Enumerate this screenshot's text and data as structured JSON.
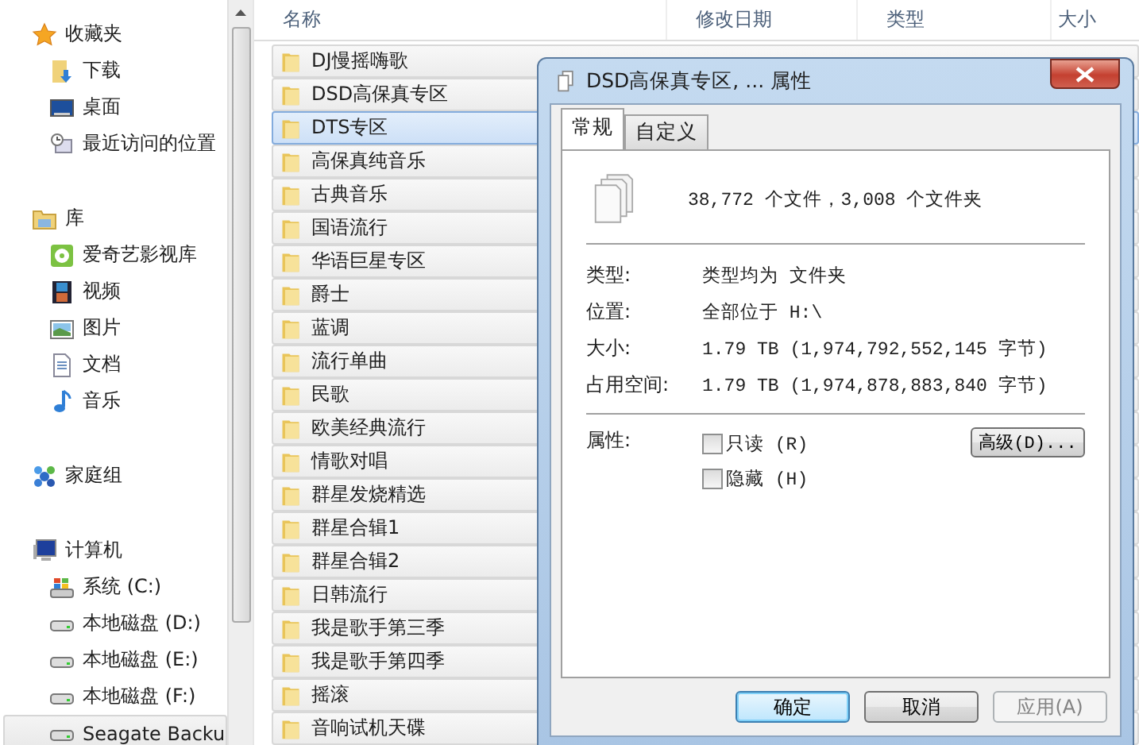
{
  "sidebar": {
    "groups": [
      {
        "label": "收藏夹",
        "kind": "favorites",
        "items": [
          {
            "label": "下载",
            "kind": "download",
            "selected": false
          },
          {
            "label": "桌面",
            "kind": "desktop",
            "selected": false
          },
          {
            "label": "最近访问的位置",
            "kind": "recent",
            "selected": false
          }
        ]
      },
      {
        "label": "库",
        "kind": "library",
        "items": [
          {
            "label": "爱奇艺影视库",
            "kind": "media",
            "selected": false
          },
          {
            "label": "视频",
            "kind": "video",
            "selected": false
          },
          {
            "label": "图片",
            "kind": "pictures",
            "selected": false
          },
          {
            "label": "文档",
            "kind": "documents",
            "selected": false
          },
          {
            "label": "音乐",
            "kind": "music",
            "selected": false
          }
        ]
      },
      {
        "label": "家庭组",
        "kind": "homegroup"
      },
      {
        "label": "计算机",
        "kind": "computer",
        "items": [
          {
            "label": "系统 (C:)",
            "kind": "system",
            "selected": false
          },
          {
            "label": "本地磁盘 (D:)",
            "kind": "drive",
            "selected": false
          },
          {
            "label": "本地磁盘 (E:)",
            "kind": "drive",
            "selected": false
          },
          {
            "label": "本地磁盘 (F:)",
            "kind": "drive",
            "selected": false
          },
          {
            "label": "Seagate Backu",
            "kind": "drive",
            "selected": true
          }
        ]
      }
    ]
  },
  "file_list": {
    "columns": [
      "名称",
      "修改日期",
      "类型",
      "大小"
    ],
    "rows": [
      {
        "name": "DJ慢摇嗨歌",
        "selected": false
      },
      {
        "name": "DSD高保真专区",
        "selected": false
      },
      {
        "name": "DTS专区",
        "selected": true
      },
      {
        "name": "高保真纯音乐",
        "selected": false
      },
      {
        "name": "古典音乐",
        "selected": false
      },
      {
        "name": "国语流行",
        "selected": false
      },
      {
        "name": "华语巨星专区",
        "selected": false
      },
      {
        "name": "爵士",
        "selected": false
      },
      {
        "name": "蓝调",
        "selected": false
      },
      {
        "name": "流行单曲",
        "selected": false
      },
      {
        "name": "民歌",
        "selected": false
      },
      {
        "name": "欧美经典流行",
        "selected": false
      },
      {
        "name": "情歌对唱",
        "selected": false
      },
      {
        "name": "群星发烧精选",
        "selected": false
      },
      {
        "name": "群星合辑1",
        "selected": false
      },
      {
        "name": "群星合辑2",
        "selected": false
      },
      {
        "name": "日韩流行",
        "selected": false
      },
      {
        "name": "我是歌手第三季",
        "selected": false
      },
      {
        "name": "我是歌手第四季",
        "selected": false
      },
      {
        "name": "摇滚",
        "selected": false
      },
      {
        "name": "音响试机天碟",
        "selected": false
      }
    ]
  },
  "dialog": {
    "title": "DSD高保真专区, ... 属性",
    "tabs": [
      {
        "label": "常规",
        "selected": true
      },
      {
        "label": "自定义",
        "selected": false
      }
    ],
    "summary": "38,772 个文件，3,008 个文件夹",
    "fields": [
      {
        "label": "类型:",
        "value": "类型均为 文件夹"
      },
      {
        "label": "位置:",
        "value": "全部位于 H:\\"
      },
      {
        "label": "大小:",
        "value": "1.79 TB (1,974,792,552,145 字节)"
      },
      {
        "label": "占用空间:",
        "value": "1.79 TB (1,974,878,883,840 字节)"
      }
    ],
    "attributes_label": "属性:",
    "attributes": [
      {
        "label": "只读 (R)",
        "checked": false
      },
      {
        "label": "隐藏 (H)",
        "checked": false
      }
    ],
    "advanced_button": "高级(D)...",
    "buttons": [
      {
        "label": "确定",
        "kind": "default"
      },
      {
        "label": "取消",
        "kind": "normal"
      },
      {
        "label": "应用(A)",
        "kind": "disabled"
      }
    ]
  }
}
